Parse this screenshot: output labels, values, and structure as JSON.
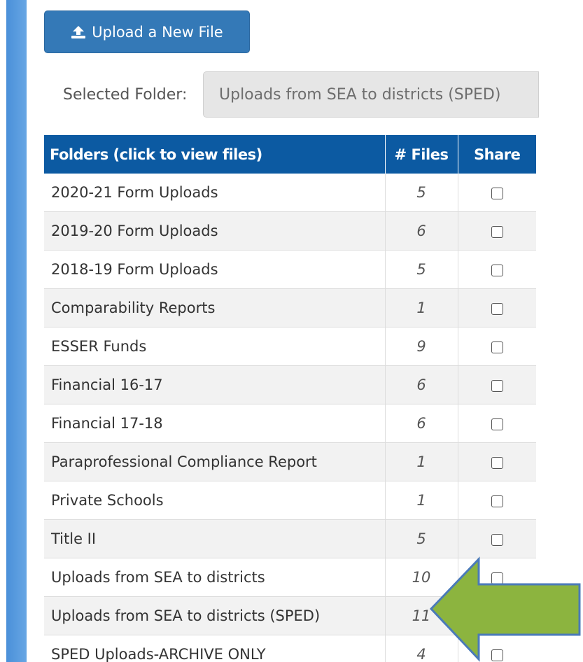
{
  "upload_button": {
    "label": "Upload a New File",
    "icon": "upload-icon"
  },
  "selected_folder": {
    "label": "Selected Folder:",
    "value": "Uploads from SEA to districts (SPED)"
  },
  "table": {
    "headers": {
      "name": "Folders (click to view files)",
      "count": "# Files",
      "share": "Share"
    },
    "rows": [
      {
        "name": "2020-21 Form Uploads",
        "count": "5",
        "share": false
      },
      {
        "name": "2019-20 Form Uploads",
        "count": "6",
        "share": false
      },
      {
        "name": "2018-19 Form Uploads",
        "count": "5",
        "share": false
      },
      {
        "name": "Comparability Reports",
        "count": "1",
        "share": false
      },
      {
        "name": "ESSER Funds",
        "count": "9",
        "share": false
      },
      {
        "name": "Financial 16-17",
        "count": "6",
        "share": false
      },
      {
        "name": "Financial 17-18",
        "count": "6",
        "share": false
      },
      {
        "name": "Paraprofessional Compliance Report",
        "count": "1",
        "share": false
      },
      {
        "name": "Private Schools",
        "count": "1",
        "share": false
      },
      {
        "name": "Title II",
        "count": "5",
        "share": false
      },
      {
        "name": "Uploads from SEA to districts",
        "count": "10",
        "share": false
      },
      {
        "name": "Uploads from SEA to districts (SPED)",
        "count": "11",
        "share": false
      },
      {
        "name": "SPED Uploads-ARCHIVE ONLY",
        "count": "4",
        "share": false
      }
    ]
  },
  "colors": {
    "primary_button": "#3479b7",
    "table_header": "#0c5aa2",
    "left_rail": "#4a90d9",
    "arrow_fill": "#8cb43f",
    "arrow_stroke": "#4a7ab8"
  }
}
